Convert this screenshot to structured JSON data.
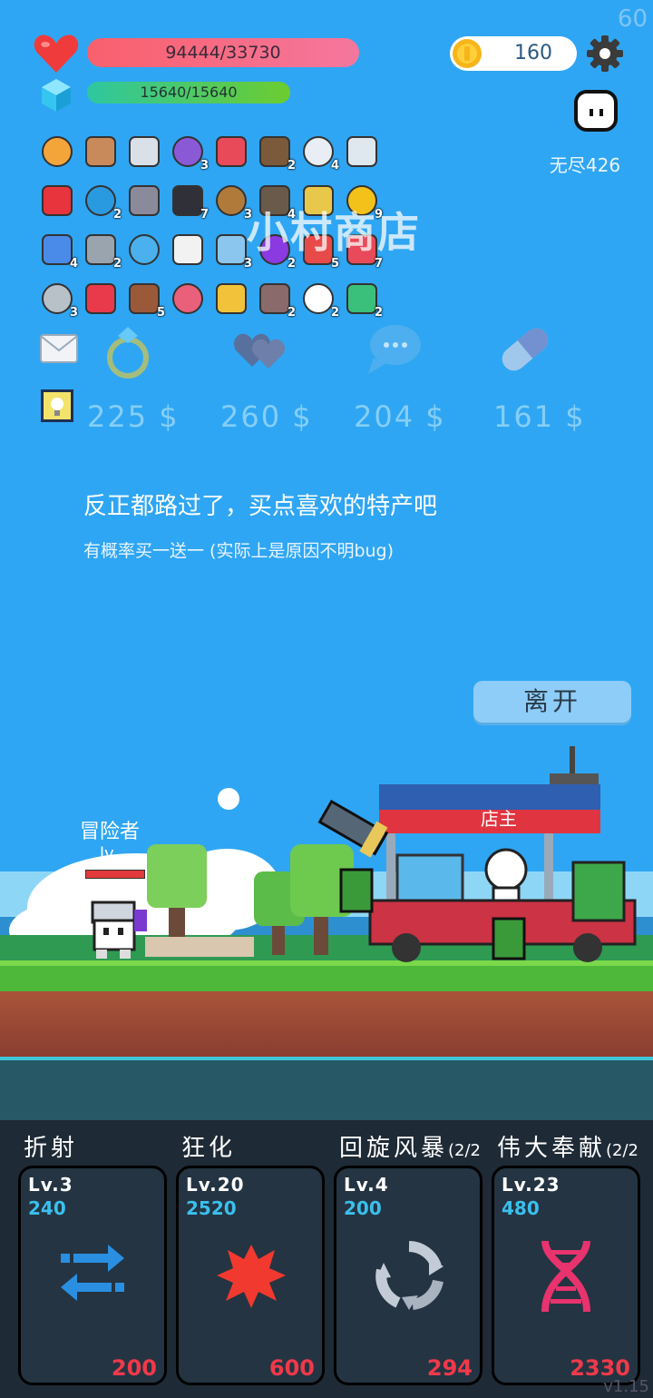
{
  "fps": "60",
  "hud": {
    "hp_text": "94444/33730",
    "mp_text": "15640/15640",
    "coins": "160",
    "mode_label": "无尽426"
  },
  "items": [
    {
      "icon": "book-icon",
      "badge": ""
    },
    {
      "icon": "shield-icon",
      "badge": ""
    },
    {
      "icon": "sword-icon",
      "badge": ""
    },
    {
      "icon": "chest-icon",
      "badge": "3"
    },
    {
      "icon": "watermelon-icon",
      "badge": ""
    },
    {
      "icon": "coconut-icon",
      "badge": "2"
    },
    {
      "icon": "lightbulb-icon",
      "badge": "4"
    },
    {
      "icon": "refresh-icon",
      "badge": ""
    },
    {
      "icon": "strawberry-icon",
      "badge": ""
    },
    {
      "icon": "gem-icon",
      "badge": "2"
    },
    {
      "icon": "viking-helmet-icon",
      "badge": ""
    },
    {
      "icon": "cauldron-icon",
      "badge": "7"
    },
    {
      "icon": "bow-icon",
      "badge": "3"
    },
    {
      "icon": "arrows-icon",
      "badge": "4"
    },
    {
      "icon": "ring-icon",
      "badge": ""
    },
    {
      "icon": "sunflower-icon",
      "badge": "9"
    },
    {
      "icon": "hook-icon",
      "badge": "4"
    },
    {
      "icon": "mace-icon",
      "badge": "2"
    },
    {
      "icon": "speech-bubble-icon",
      "badge": ""
    },
    {
      "icon": "dice-icon",
      "badge": ""
    },
    {
      "icon": "bomb-icon",
      "badge": "3"
    },
    {
      "icon": "potion-icon",
      "badge": "2"
    },
    {
      "icon": "badge-shield-icon",
      "badge": "5"
    },
    {
      "icon": "pill-icon",
      "badge": "7"
    },
    {
      "icon": "axe-icon",
      "badge": "3"
    },
    {
      "icon": "hearts-icon",
      "badge": ""
    },
    {
      "icon": "cupcake-icon",
      "badge": "5"
    },
    {
      "icon": "jam-jar-icon",
      "badge": ""
    },
    {
      "icon": "magic-wand-icon",
      "badge": ""
    },
    {
      "icon": "tombstone-icon",
      "badge": "2"
    },
    {
      "icon": "ghost-icon",
      "badge": "2"
    },
    {
      "icon": "bulb-plant-icon",
      "badge": "2"
    }
  ],
  "shop": {
    "title": "小村商店",
    "products": [
      {
        "icon": "ring-icon",
        "price": "225 $"
      },
      {
        "icon": "hearts-icon",
        "price": "260 $"
      },
      {
        "icon": "speech-bubble-icon",
        "price": "204 $"
      },
      {
        "icon": "pill-icon",
        "price": "161 $"
      }
    ],
    "message": "反正都路过了，买点喜欢的特产吧",
    "submessage": "有概率买一送一 (实际上是原因不明bug)",
    "leave_label": "离开"
  },
  "scene": {
    "hero_name": "冒险者",
    "hero_level": "lv",
    "owner_label": "店主"
  },
  "skills": [
    {
      "name": "折射",
      "level": "Lv.3",
      "power": "240",
      "cost": "200",
      "icon": "swap-arrows-icon",
      "color": "#2a8fe0"
    },
    {
      "name": "狂化",
      "level": "Lv.20",
      "power": "2520",
      "cost": "600",
      "icon": "splat-icon",
      "color": "#f2392f"
    },
    {
      "name": "回旋风暴",
      "suffix": "(2/2",
      "level": "Lv.4",
      "power": "200",
      "cost": "294",
      "icon": "cycle-icon",
      "color": "#b9c2cc"
    },
    {
      "name": "伟大奉献",
      "suffix": "(2/2",
      "level": "Lv.23",
      "power": "480",
      "cost": "2330",
      "icon": "dna-icon",
      "color": "#e8336e"
    }
  ],
  "version": "v1.15"
}
